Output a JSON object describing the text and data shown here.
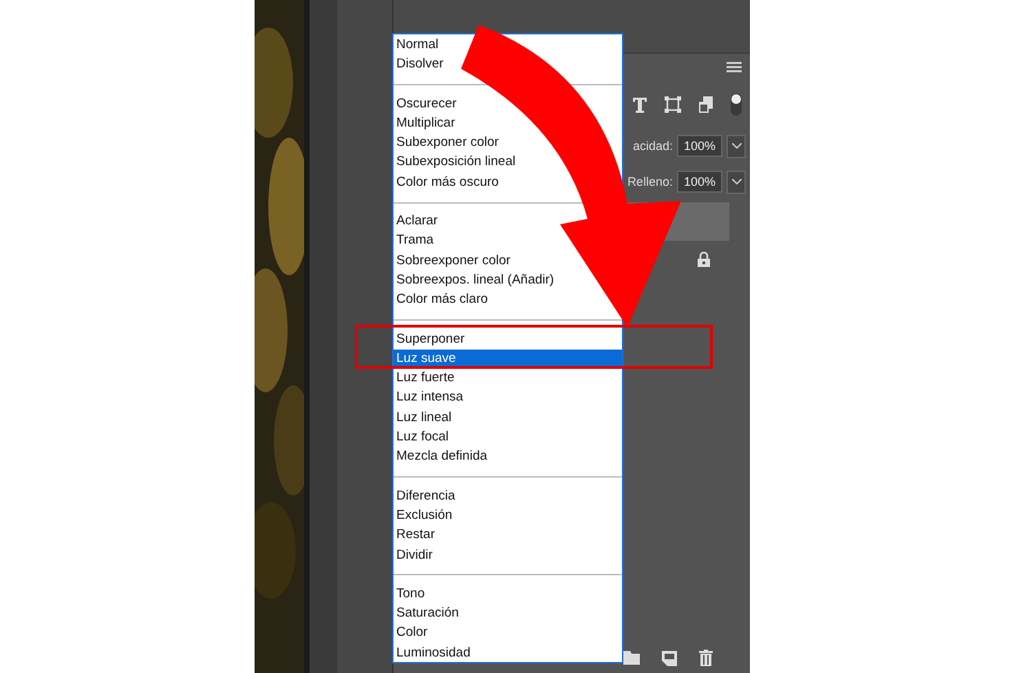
{
  "blend_menu": {
    "groups": [
      {
        "items": [
          {
            "label": "Normal",
            "selected": false
          },
          {
            "label": "Disolver",
            "selected": false
          }
        ]
      },
      {
        "items": [
          {
            "label": "Oscurecer",
            "selected": false
          },
          {
            "label": "Multiplicar",
            "selected": false
          },
          {
            "label": "Subexponer color",
            "selected": false
          },
          {
            "label": "Subexposición lineal",
            "selected": false
          },
          {
            "label": "Color más oscuro",
            "selected": false
          }
        ]
      },
      {
        "items": [
          {
            "label": "Aclarar",
            "selected": false
          },
          {
            "label": "Trama",
            "selected": false
          },
          {
            "label": "Sobreexponer color",
            "selected": false
          },
          {
            "label": "Sobreexpos. lineal (Añadir)",
            "selected": false
          },
          {
            "label": "Color más claro",
            "selected": false
          }
        ]
      },
      {
        "items": [
          {
            "label": "Superponer",
            "selected": false
          },
          {
            "label": "Luz suave",
            "selected": true
          },
          {
            "label": "Luz fuerte",
            "selected": false
          },
          {
            "label": "Luz intensa",
            "selected": false
          },
          {
            "label": "Luz lineal",
            "selected": false
          },
          {
            "label": "Luz focal",
            "selected": false
          },
          {
            "label": "Mezcla definida",
            "selected": false
          }
        ]
      },
      {
        "items": [
          {
            "label": "Diferencia",
            "selected": false
          },
          {
            "label": "Exclusión",
            "selected": false
          },
          {
            "label": "Restar",
            "selected": false
          },
          {
            "label": "Dividir",
            "selected": false
          }
        ]
      },
      {
        "items": [
          {
            "label": "Tono",
            "selected": false
          },
          {
            "label": "Saturación",
            "selected": false
          },
          {
            "label": "Color",
            "selected": false
          },
          {
            "label": "Luminosidad",
            "selected": false
          }
        ]
      }
    ]
  },
  "layers_panel": {
    "toggle": {
      "on": true
    },
    "opacity": {
      "label": "acidad:",
      "value": "100%"
    },
    "fill": {
      "label": "Relleno:",
      "value": "100%"
    }
  }
}
